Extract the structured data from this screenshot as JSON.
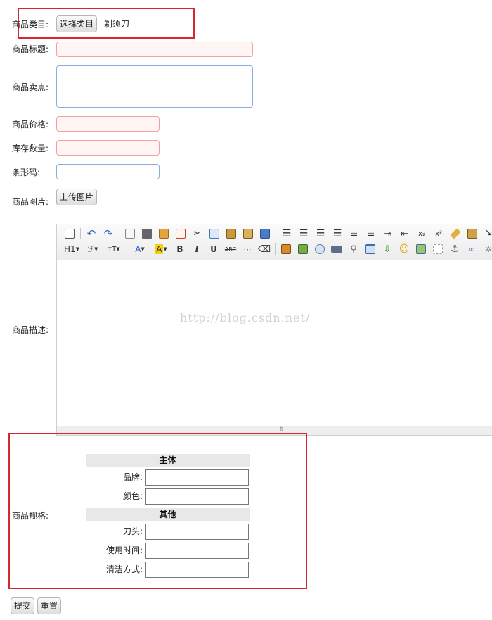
{
  "form": {
    "category": {
      "label": "商品类目:",
      "button": "选择类目",
      "value": "剃须刀"
    },
    "title": {
      "label": "商品标题:",
      "value": "",
      "placeholder": ""
    },
    "sellpoint": {
      "label": "商品卖点:",
      "value": ""
    },
    "price": {
      "label": "商品价格:",
      "value": ""
    },
    "stock": {
      "label": "库存数量:",
      "value": ""
    },
    "barcode": {
      "label": "条形码:",
      "value": ""
    },
    "image": {
      "label": "商品图片:",
      "button": "上传图片"
    },
    "desc": {
      "label": "商品描述:"
    },
    "spec": {
      "label": "商品规格:"
    }
  },
  "editor": {
    "row2": {
      "heading": "H1",
      "font": "ℱ",
      "size": "тT",
      "bold": "B",
      "italic": "I",
      "underline": "U",
      "strike": "ABC"
    },
    "watermark": "http://blog.csdn.net/"
  },
  "spec": {
    "groups": [
      {
        "name": "主体",
        "params": [
          {
            "label": "品牌:"
          },
          {
            "label": "颜色:"
          }
        ]
      },
      {
        "name": "其他",
        "params": [
          {
            "label": "刀头:"
          },
          {
            "label": "使用时间:"
          },
          {
            "label": "清洁方式:"
          }
        ]
      }
    ]
  },
  "actions": {
    "submit": "提交",
    "reset": "重置"
  },
  "colors": {
    "highlight_box": "#d8262f",
    "invalid_border": "#f2a0a0",
    "field_border": "#8aaedc"
  }
}
